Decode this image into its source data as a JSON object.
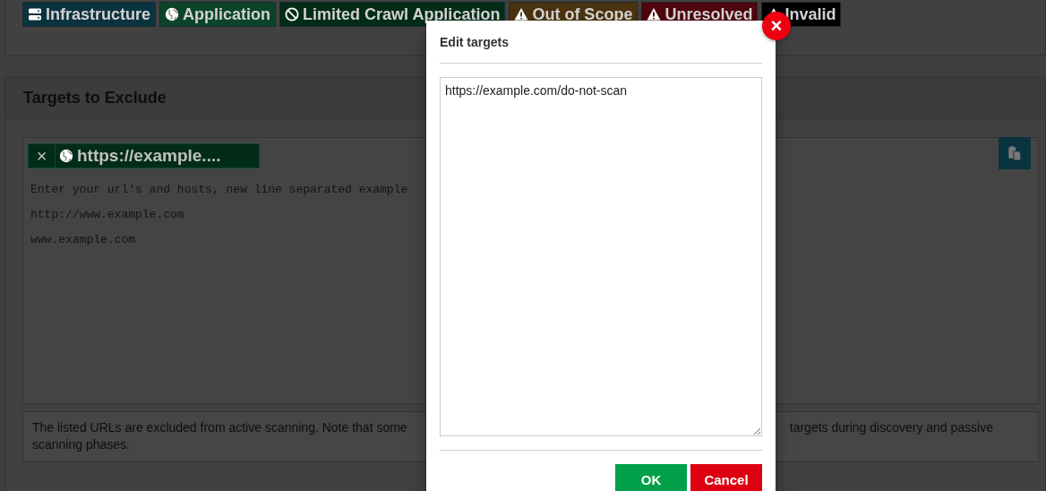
{
  "scope_badges": [
    {
      "label": "Infrastructure",
      "kind": "server",
      "color": "#0a3340"
    },
    {
      "label": "Application",
      "kind": "globe",
      "color": "#0b4428"
    },
    {
      "label": "Limited Crawl Application",
      "kind": "blocked",
      "color": "#032c18"
    },
    {
      "label": "Out of Scope",
      "kind": "warning",
      "color": "#4a320f"
    },
    {
      "label": "Unresolved",
      "kind": "warning",
      "color": "#4e050d"
    },
    {
      "label": "Invalid",
      "kind": "warning",
      "color": "#000000"
    }
  ],
  "exclude_section": {
    "title": "Targets to Exclude",
    "target_chips": [
      {
        "label": "https://example....",
        "remove": "×"
      }
    ],
    "placeholder_lines": [
      "Enter your url's and hosts, new line separated example",
      "http://www.example.com",
      "www.example.com"
    ],
    "description": {
      "line_1_start": "The listed URLs are excluded from active scanning. Note that some",
      "line_1_end": "targets during discovery and passive",
      "line_2": "scanning phases."
    }
  },
  "modal": {
    "title": "Edit targets",
    "close": "×",
    "value": "https://example.com/do-not-scan",
    "buttons": [
      {
        "label": "OK",
        "kind": "primary"
      },
      {
        "label": "Cancel",
        "kind": "danger"
      }
    ]
  }
}
